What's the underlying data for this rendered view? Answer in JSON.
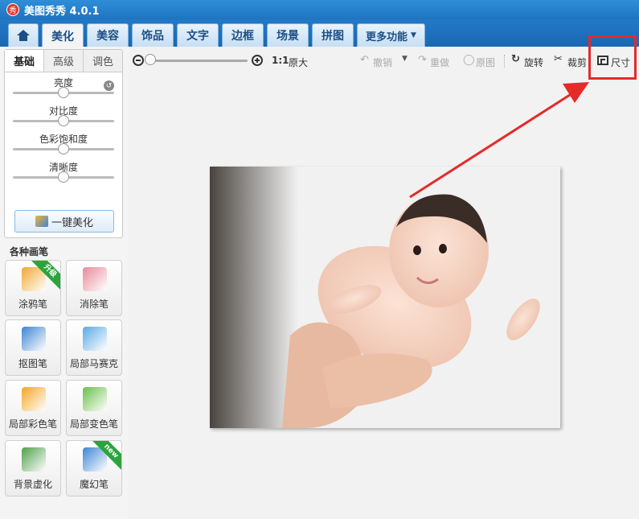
{
  "app": {
    "title": "美图秀秀 4.0.1",
    "logo_text": "秀"
  },
  "tabs": [
    {
      "label": "美化"
    },
    {
      "label": "美容"
    },
    {
      "label": "饰品"
    },
    {
      "label": "文字"
    },
    {
      "label": "边框"
    },
    {
      "label": "场景"
    },
    {
      "label": "拼图"
    },
    {
      "label": "更多功能"
    }
  ],
  "subtabs": [
    {
      "label": "基础"
    },
    {
      "label": "高级"
    },
    {
      "label": "调色"
    }
  ],
  "sliders": [
    {
      "label": "亮度",
      "value": 0.5
    },
    {
      "label": "对比度",
      "value": 0.5
    },
    {
      "label": "色彩饱和度",
      "value": 0.5
    },
    {
      "label": "清晰度",
      "value": 0.5
    }
  ],
  "oneclick_label": "一键美化",
  "brushes_title": "各种画笔",
  "brushes": [
    {
      "label": "涂鸦笔",
      "badge": "升级",
      "icon": "paintbrush-icon",
      "color": "#f0a830"
    },
    {
      "label": "消除笔",
      "badge": "",
      "icon": "eraser-icon",
      "color": "#e98a9a"
    },
    {
      "label": "抠图笔",
      "badge": "",
      "icon": "pen-icon",
      "color": "#3d86d4"
    },
    {
      "label": "局部马赛克",
      "badge": "",
      "icon": "mosaic-icon",
      "color": "#5aa9e6"
    },
    {
      "label": "局部彩色笔",
      "badge": "",
      "icon": "color-brush-icon",
      "color": "#f5a623"
    },
    {
      "label": "局部变色笔",
      "badge": "",
      "icon": "paint-bucket-icon",
      "color": "#6abf4b"
    },
    {
      "label": "背景虚化",
      "badge": "",
      "icon": "blur-icon",
      "color": "#4fa04a"
    },
    {
      "label": "魔幻笔",
      "badge": "new",
      "icon": "magic-wand-icon",
      "color": "#3d86d4"
    }
  ],
  "toolbar": {
    "ratio": "1:1",
    "original_size": "原大",
    "undo": "撤销",
    "redo": "重做",
    "original": "原图",
    "rotate": "旋转",
    "crop": "裁剪",
    "resize": "尺寸"
  },
  "zoom_level": 0.02,
  "colors": {
    "accent": "#1f74bf",
    "highlight": "#e52a2a"
  }
}
